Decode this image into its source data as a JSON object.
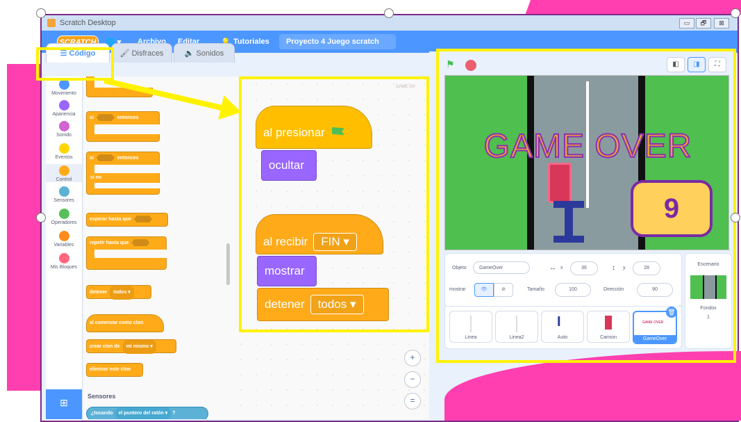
{
  "window": {
    "title": "Scratch Desktop",
    "min": "▭",
    "max": "🗗",
    "close": "⊠"
  },
  "menubar": {
    "logo": "SCRATCH",
    "globe": "🌐 ▾",
    "file": "Archivo",
    "edit": "Editar",
    "tutorials": "Tutoriales",
    "project_title": "Proyecto 4 Juego scratch"
  },
  "tabs": {
    "code": "Código",
    "costumes": "Disfraces",
    "sounds": "Sonidos"
  },
  "categories": [
    {
      "label": "Movimiento",
      "color": "#4c97ff"
    },
    {
      "label": "Apariencia",
      "color": "#9966ff"
    },
    {
      "label": "Sonido",
      "color": "#cf63cf"
    },
    {
      "label": "Eventos",
      "color": "#ffd500"
    },
    {
      "label": "Control",
      "color": "#ffab19"
    },
    {
      "label": "Sensores",
      "color": "#5cb1d6"
    },
    {
      "label": "Operadores",
      "color": "#59c059"
    },
    {
      "label": "Variables",
      "color": "#ff8c1a"
    },
    {
      "label": "Mis Bloques",
      "color": "#ff6680"
    }
  ],
  "palette": {
    "if_then_prefix": "si",
    "if_then_suffix": "entonces",
    "if_else_prefix": "si",
    "if_else_suffix": "entonces",
    "else_label": "si no",
    "wait_until": "esperar hasta que",
    "repeat_until": "repetir hasta que",
    "stop_label": "detener",
    "stop_value": "todos ▾",
    "when_clone": "al comenzar como clon",
    "create_clone": "crear clon de",
    "create_clone_value": "mí mismo ▾",
    "delete_clone": "eliminar este clon",
    "sensing_title": "Sensores",
    "touching_label": "¿tocando",
    "touching_value": "el puntero del ratón ▾",
    "touching_end": "?"
  },
  "script": {
    "watermark": "GAME OV",
    "when_flag": "al presionar",
    "hide": "ocultar",
    "when_receive": "al recibir",
    "when_receive_value": "FIN ▾",
    "show": "mostrar",
    "stop": "detener",
    "stop_value": "todos ▾"
  },
  "zoom": {
    "in": "+",
    "out": "−",
    "reset": "="
  },
  "stage": {
    "game_over_text": "GAME OVER",
    "score": "9",
    "buttons": [
      "◧",
      "◨",
      "⛶"
    ]
  },
  "sprite_info": {
    "sprite_label": "Objeto",
    "sprite_name": "GameOver",
    "x_label": "x",
    "x_value": "36",
    "y_label": "y",
    "y_value": "28",
    "show_label": "mostrar",
    "size_label": "Tamaño",
    "size_value": "100",
    "direction_label": "Dirección",
    "direction_value": "90"
  },
  "sprites": [
    {
      "name": "Linea"
    },
    {
      "name": "Linea2"
    },
    {
      "name": "Auto"
    },
    {
      "name": "Camion"
    },
    {
      "name": "GameOver",
      "selected": true
    }
  ],
  "backdrop": {
    "title": "Escenario",
    "label": "Fondos",
    "count": "1"
  }
}
